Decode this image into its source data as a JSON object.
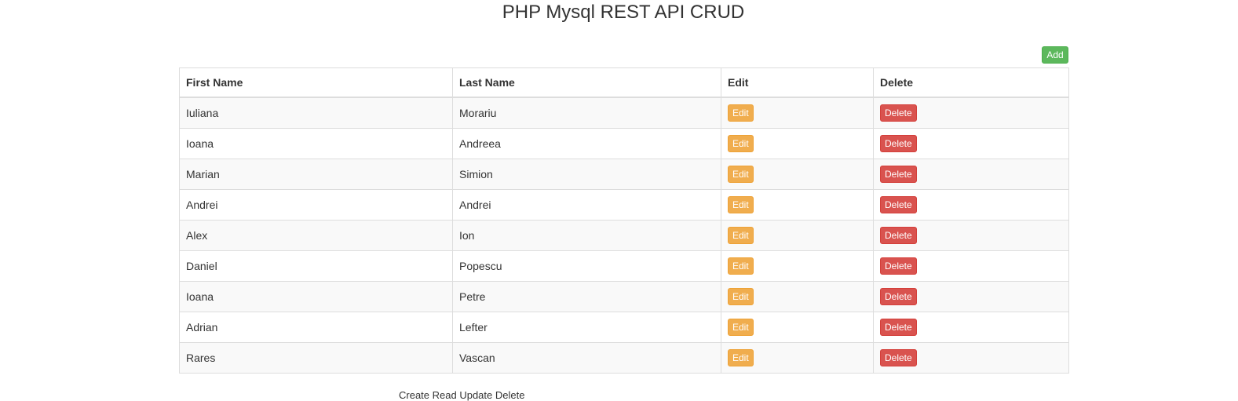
{
  "page": {
    "title": "PHP Mysql REST API CRUD"
  },
  "toolbar": {
    "add_label": "Add"
  },
  "table": {
    "headers": [
      "First Name",
      "Last Name",
      "Edit",
      "Delete"
    ],
    "rows": [
      {
        "first_name": "Iuliana",
        "last_name": "Morariu",
        "edit_label": "Edit",
        "delete_label": "Delete"
      },
      {
        "first_name": "Ioana",
        "last_name": "Andreea",
        "edit_label": "Edit",
        "delete_label": "Delete"
      },
      {
        "first_name": "Marian",
        "last_name": "Simion",
        "edit_label": "Edit",
        "delete_label": "Delete"
      },
      {
        "first_name": "Andrei",
        "last_name": "Andrei",
        "edit_label": "Edit",
        "delete_label": "Delete"
      },
      {
        "first_name": "Alex",
        "last_name": "Ion",
        "edit_label": "Edit",
        "delete_label": "Delete"
      },
      {
        "first_name": "Daniel",
        "last_name": "Popescu",
        "edit_label": "Edit",
        "delete_label": "Delete"
      },
      {
        "first_name": "Ioana",
        "last_name": "Petre",
        "edit_label": "Edit",
        "delete_label": "Delete"
      },
      {
        "first_name": "Adrian",
        "last_name": "Lefter",
        "edit_label": "Edit",
        "delete_label": "Delete"
      },
      {
        "first_name": "Rares",
        "last_name": "Vascan",
        "edit_label": "Edit",
        "delete_label": "Delete"
      }
    ]
  },
  "footer": {
    "text": "Create Read Update Delete"
  },
  "colors": {
    "add_button": "#5cb85c",
    "edit_button": "#f0ad4e",
    "delete_button": "#d9534f",
    "border": "#dddddd",
    "stripe": "#f9f9f9"
  }
}
